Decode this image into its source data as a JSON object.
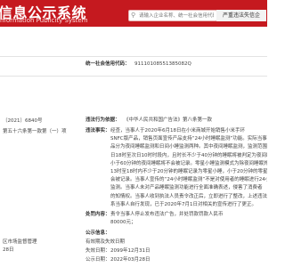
{
  "header": {
    "logo_cn": "信息公示系统",
    "logo_en": "nformation Publicity System",
    "search_placeholder": "请输入企业名称、统一社会信用代码或注册号",
    "search_button": "严重违法失信企"
  },
  "credit": {
    "label": "统一社会信用代码：",
    "value": "91110108551385082Q"
  },
  "left_labels": {
    "decision_no": "〔2021〕6840号",
    "article": "第五十六条第一款第（一）项",
    "authority": "区市场监督管理",
    "date": "28日"
  },
  "basis": {
    "label": "违法行为依据：",
    "value": "《中华人民共和国广告法》第八条第一款"
  },
  "facts": {
    "label": "违法事实：",
    "lines": [
      "经查，当事人于2020年6月18日在小米商城开始销售小米手环",
      "SNFC版产品，销售页面宣传产品支持“24小时睡眠监测”功能。实际当事人产",
      "品分为夜间睡眠监测和日间小睡监测两种。其中夜间睡眠监测，监测范围为",
      "日18时至次日10时时段内，且时长不少于40分钟的睡眠将被判定为夜间睡眠，",
      "小于60分钟的夜间睡眠将不会被记录。零星小睡监测模式为除夜间睡眠外的时",
      "13时至18时内不少于20分钟的睡眠记录为零星小睡，小于20分钟的零星小睡",
      "会被记录。当事人宣传的“24小时睡眠监测”不是对使用者的睡眠进行24小时",
      "监测。当事人未对产品睡眠监测功能进行全面准确表述，侵害了消费者",
      "的知情权。当事人收到执法人员责令改正后，立即进行了整改，上述违法行为",
      "系当事人自行发现，已于2020年7月1日对相关的宣传进行了更正。"
    ]
  },
  "penalty": {
    "label": "处罚内容：",
    "line1": "责令当事人停止发布违法广告，并处罚款罚款人民币",
    "line2": "80000元；"
  },
  "publicity": {
    "label": "公示信息：",
    "sub_label": "有效期及失效日期",
    "end_label": "失效日期：",
    "end_value": "2099年12月31日",
    "date_label": "公示日期：",
    "date_value": "2022年03月28日"
  },
  "colors": {
    "header_bg": "#c5191f",
    "search_btn_bg": "#f3f3f3"
  }
}
